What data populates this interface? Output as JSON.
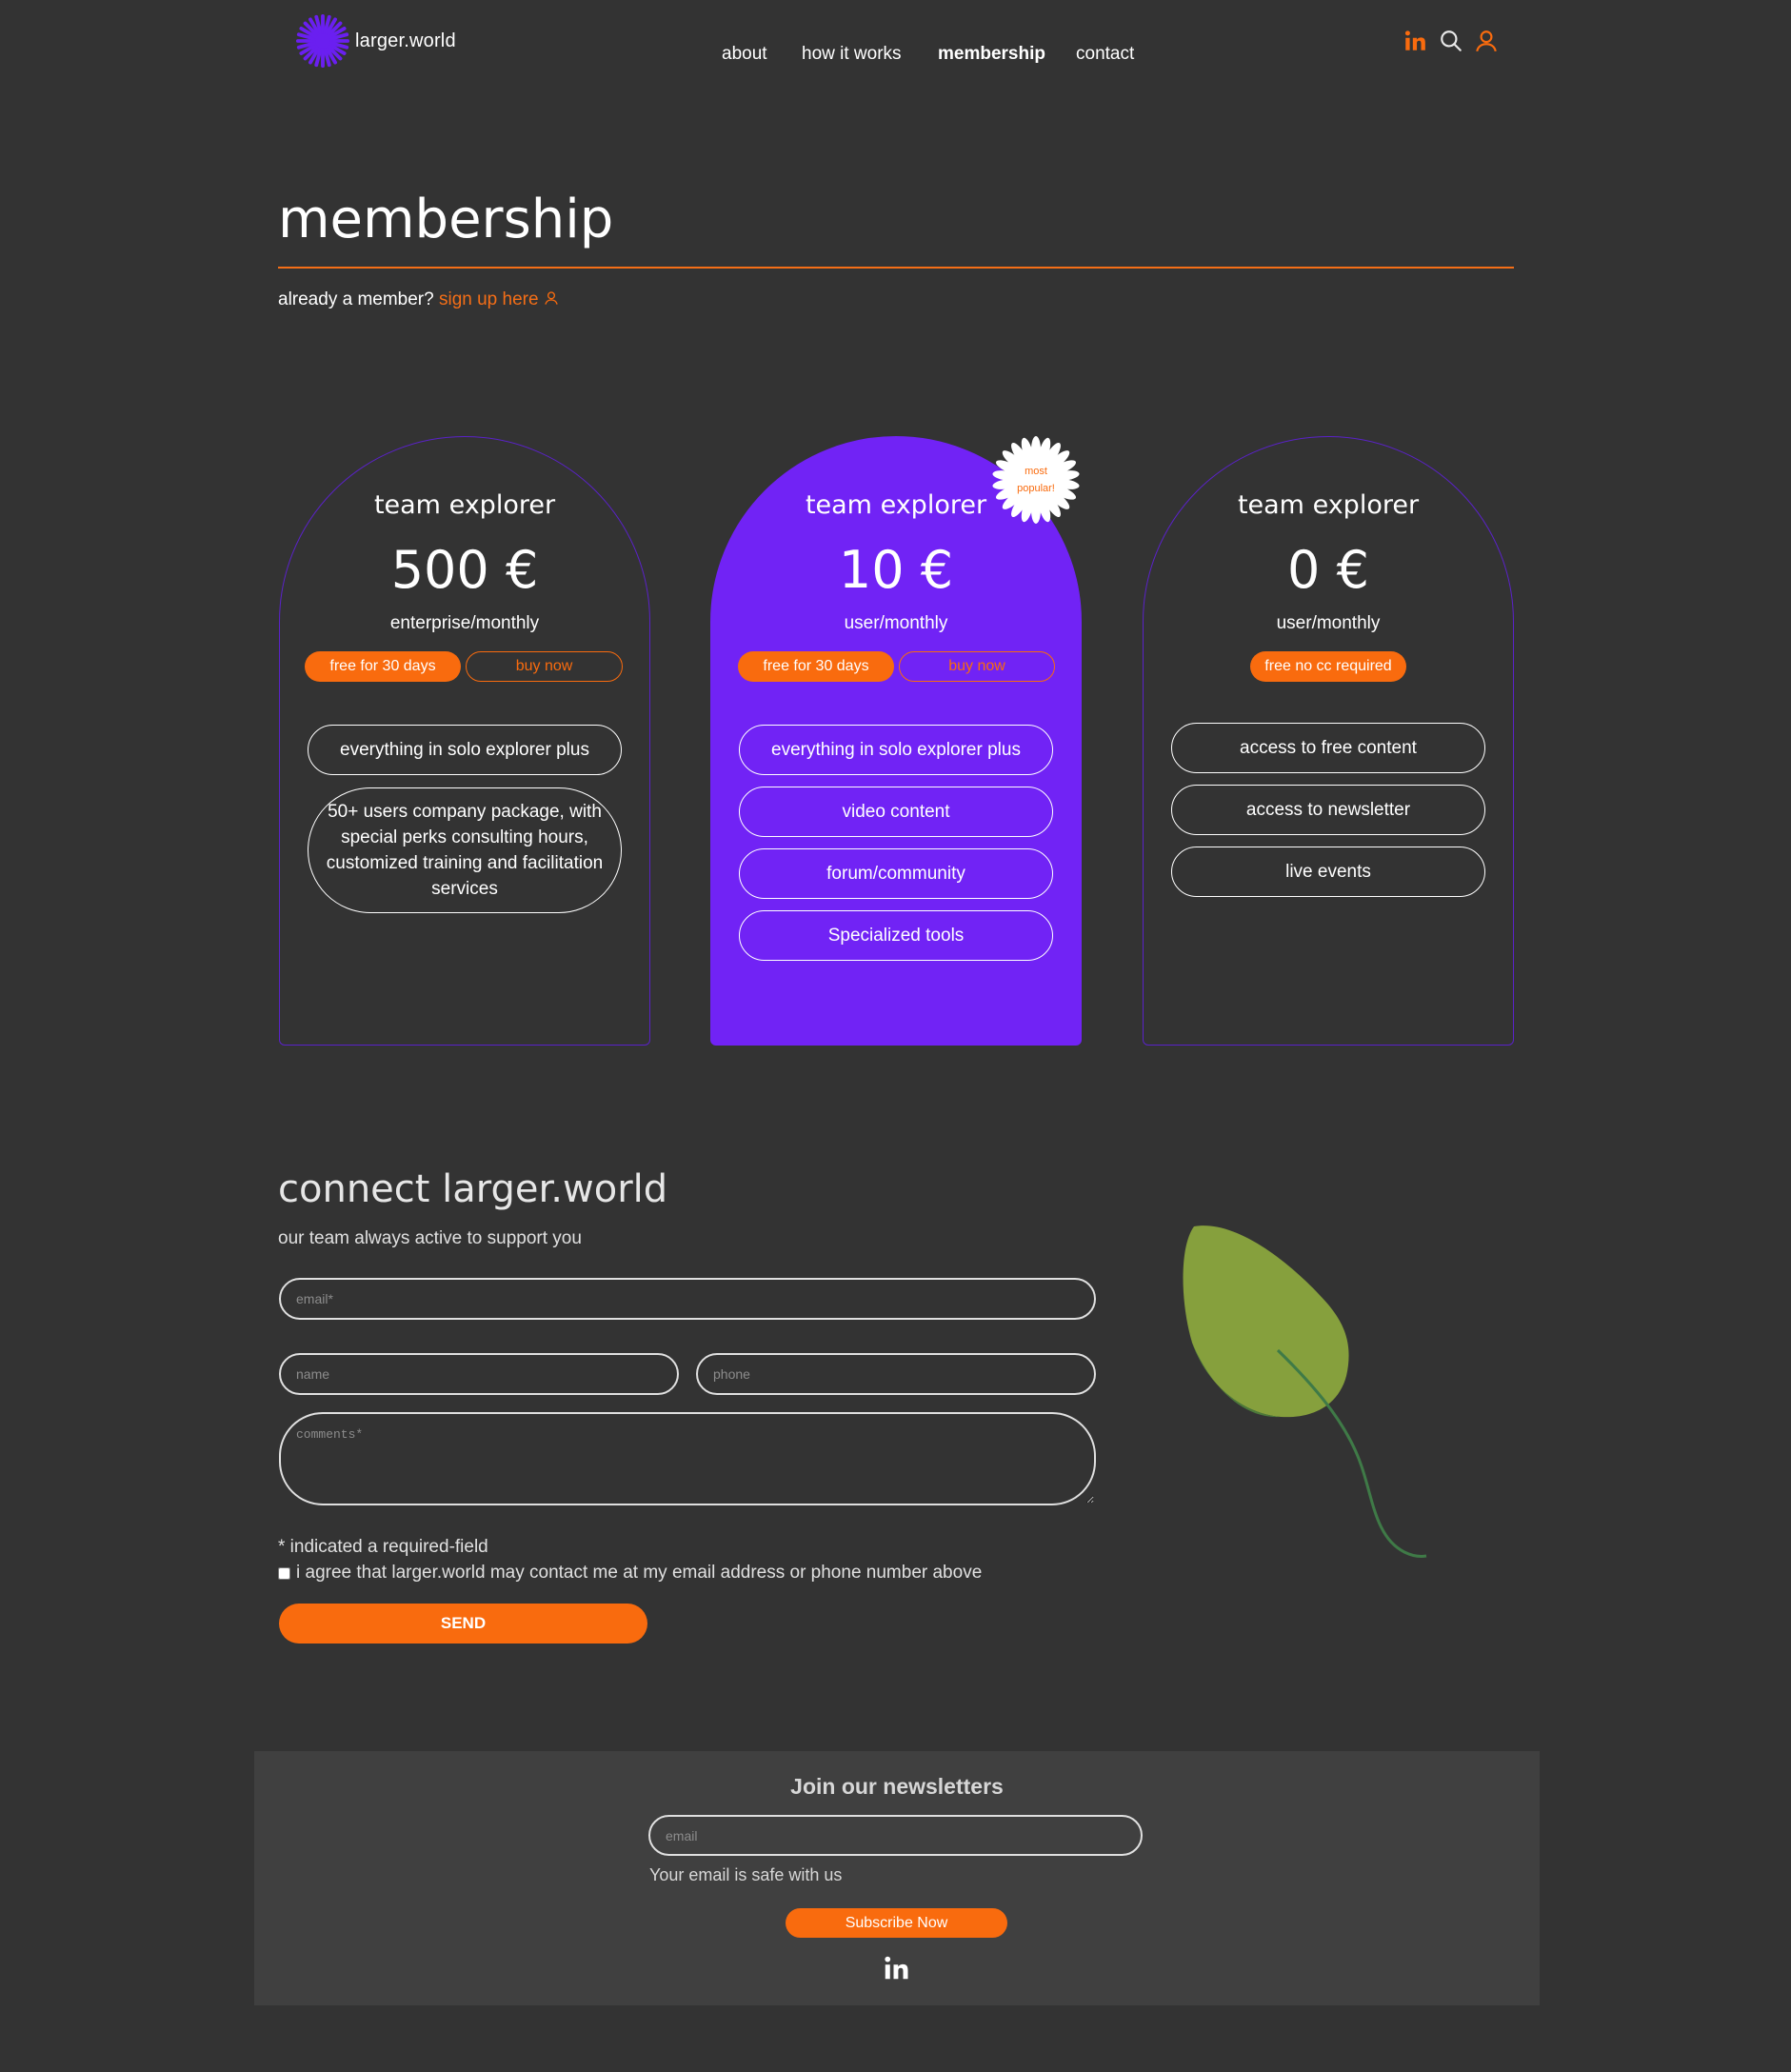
{
  "header": {
    "brand": "larger.world",
    "nav": [
      "about",
      "how it works",
      "membership",
      "contact"
    ],
    "active_nav": "membership",
    "icons": [
      "linkedin-icon",
      "search-icon",
      "user-icon"
    ]
  },
  "page": {
    "title": "membership",
    "member_prompt": "already a member?",
    "signup_link": "sign up here"
  },
  "plans": [
    {
      "name": "team explorer",
      "price": "500 €",
      "unit": "enterprise/monthly",
      "free_label": "free for 30 days",
      "buy_label": "buy now",
      "features": [
        "everything in solo explorer plus",
        "50+ users company package, with special perks consulting hours, customized training and facilitation services"
      ]
    },
    {
      "name": "team explorer",
      "price": "10 €",
      "unit": "user/monthly",
      "free_label": "free for 30 days",
      "buy_label": "buy now",
      "badge": "most popular!",
      "features": [
        "everything in solo explorer plus",
        "video content",
        "forum/community",
        "Specialized tools"
      ]
    },
    {
      "name": "team explorer",
      "price": "0 €",
      "unit": "user/monthly",
      "free_label": "free no cc required",
      "features": [
        "access to free content",
        "access to newsletter",
        "live events"
      ]
    }
  ],
  "connect": {
    "title": "connect larger.world",
    "subtitle": "our team always active to support you",
    "email_placeholder": "email*",
    "name_placeholder": "name",
    "phone_placeholder": "phone",
    "comments_placeholder": "comments*",
    "required_note": "* indicated a required-field",
    "agree_text": "i agree that larger.world may contact me at my email address or phone number above",
    "send_label": "SEND"
  },
  "newsletter": {
    "title": "Join our newsletters",
    "email_placeholder": "email",
    "safe_note": "Your email is safe with us",
    "subscribe_label": "Subscribe Now"
  },
  "colors": {
    "background": "#333333",
    "accent_orange": "#f96b0e",
    "accent_purple": "#7123f5",
    "newsletter_bg": "#404040"
  }
}
